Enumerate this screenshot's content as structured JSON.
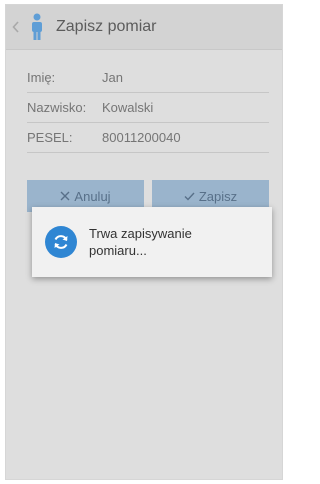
{
  "appbar": {
    "title": "Zapisz pomiar",
    "back_icon": "chevron-left-icon",
    "app_icon": "person-icon"
  },
  "form": {
    "fields": [
      {
        "label": "Imię:",
        "value": "Jan"
      },
      {
        "label": "Nazwisko:",
        "value": "Kowalski"
      },
      {
        "label": "PESEL:",
        "value": "80011200040"
      }
    ]
  },
  "buttons": {
    "cancel_label": "Anuluj",
    "save_label": "Zapisz"
  },
  "dialog": {
    "message": "Trwa zapisywanie pomiaru...",
    "icon": "sync-icon"
  },
  "colors": {
    "accent": "#2f86d3",
    "button_bg": "#9ab4cc"
  }
}
